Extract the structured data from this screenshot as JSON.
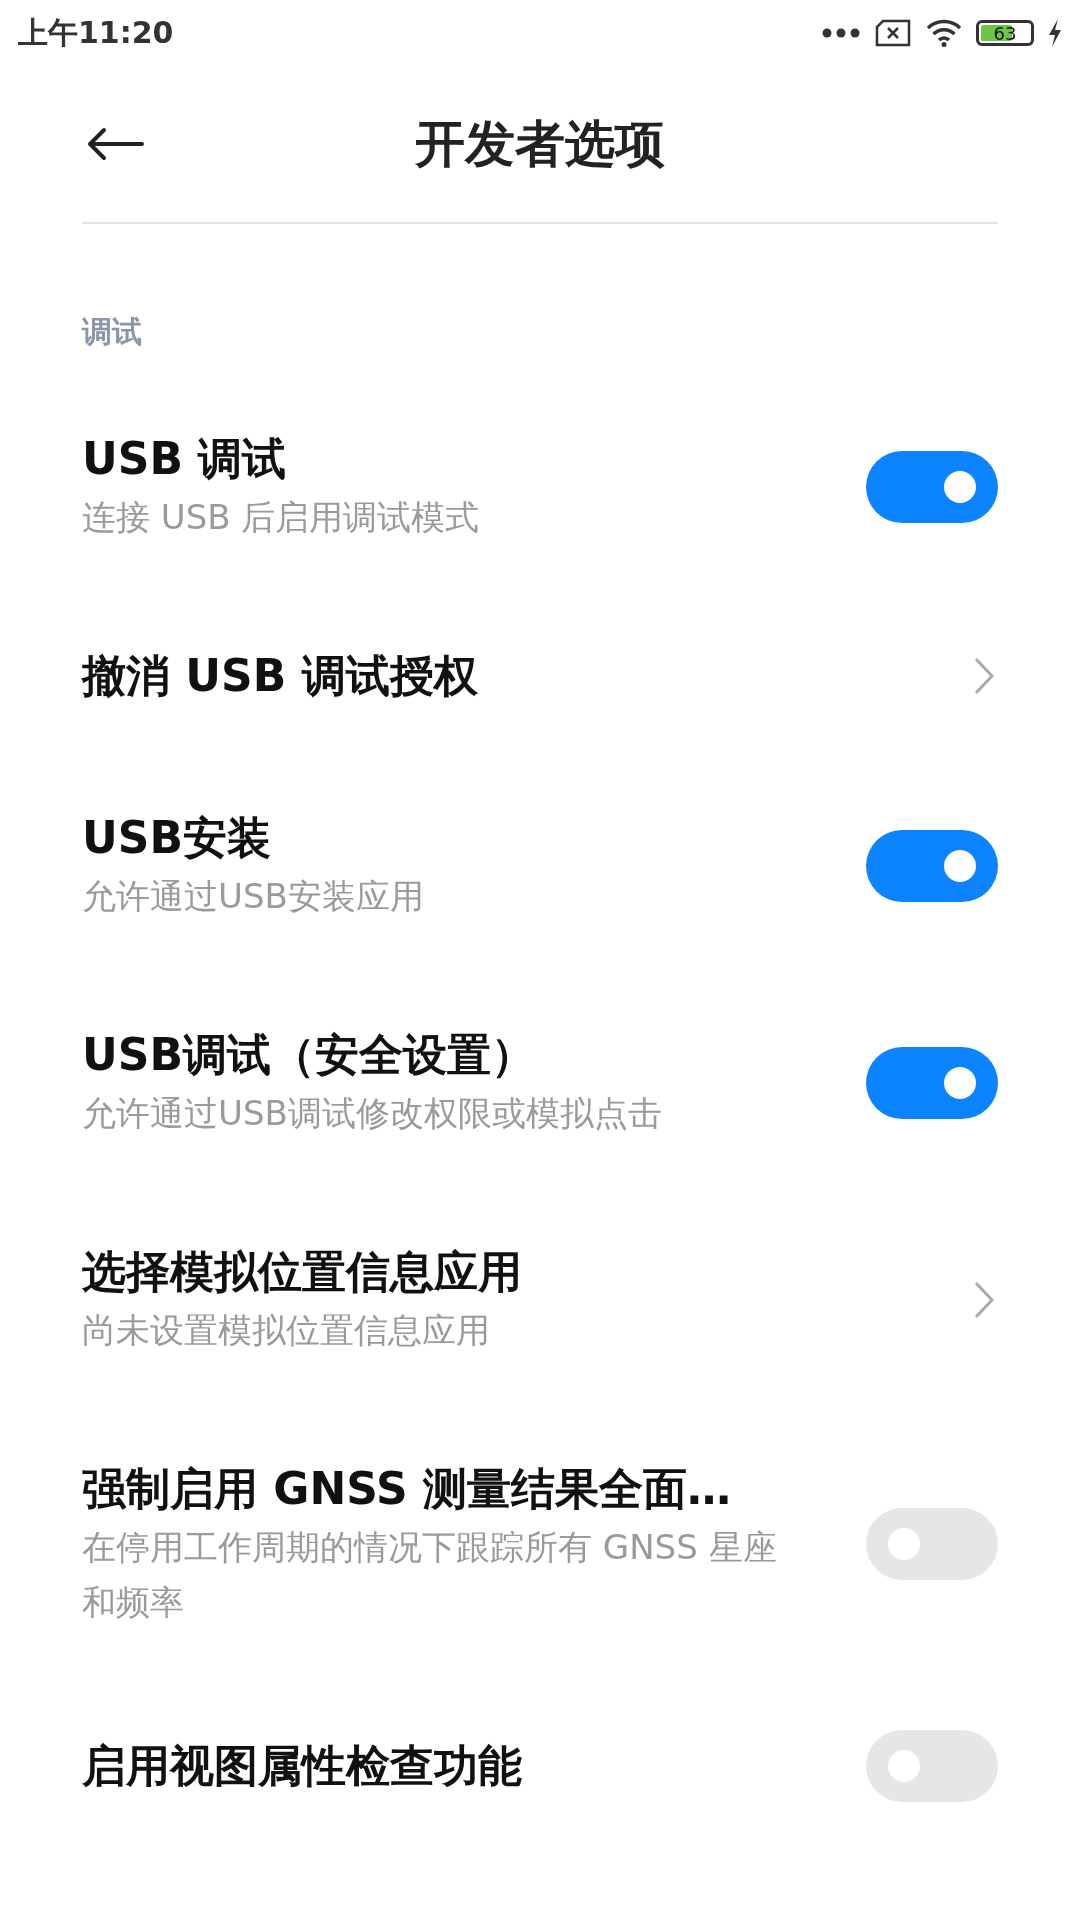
{
  "status_bar": {
    "time": "上午11:20",
    "battery": "63"
  },
  "header": {
    "title": "开发者选项"
  },
  "section": {
    "label": "调试"
  },
  "items": [
    {
      "kind": "toggle",
      "title": "USB 调试",
      "subtitle": "连接 USB 后启用调试模式",
      "on": true
    },
    {
      "kind": "link",
      "title": "撤消 USB 调试授权"
    },
    {
      "kind": "toggle",
      "title": "USB安装",
      "subtitle": "允许通过USB安装应用",
      "on": true
    },
    {
      "kind": "toggle",
      "title": "USB调试（安全设置）",
      "subtitle": "允许通过USB调试修改权限或模拟点击",
      "on": true
    },
    {
      "kind": "link",
      "title": "选择模拟位置信息应用",
      "subtitle": "尚未设置模拟位置信息应用"
    },
    {
      "kind": "toggle",
      "title": "强制启用 GNSS 测量结果全面…",
      "subtitle": "在停用工作周期的情况下跟踪所有 GNSS 星座和频率",
      "on": false
    },
    {
      "kind": "toggle",
      "title": "启用视图属性检查功能",
      "on": false
    }
  ]
}
